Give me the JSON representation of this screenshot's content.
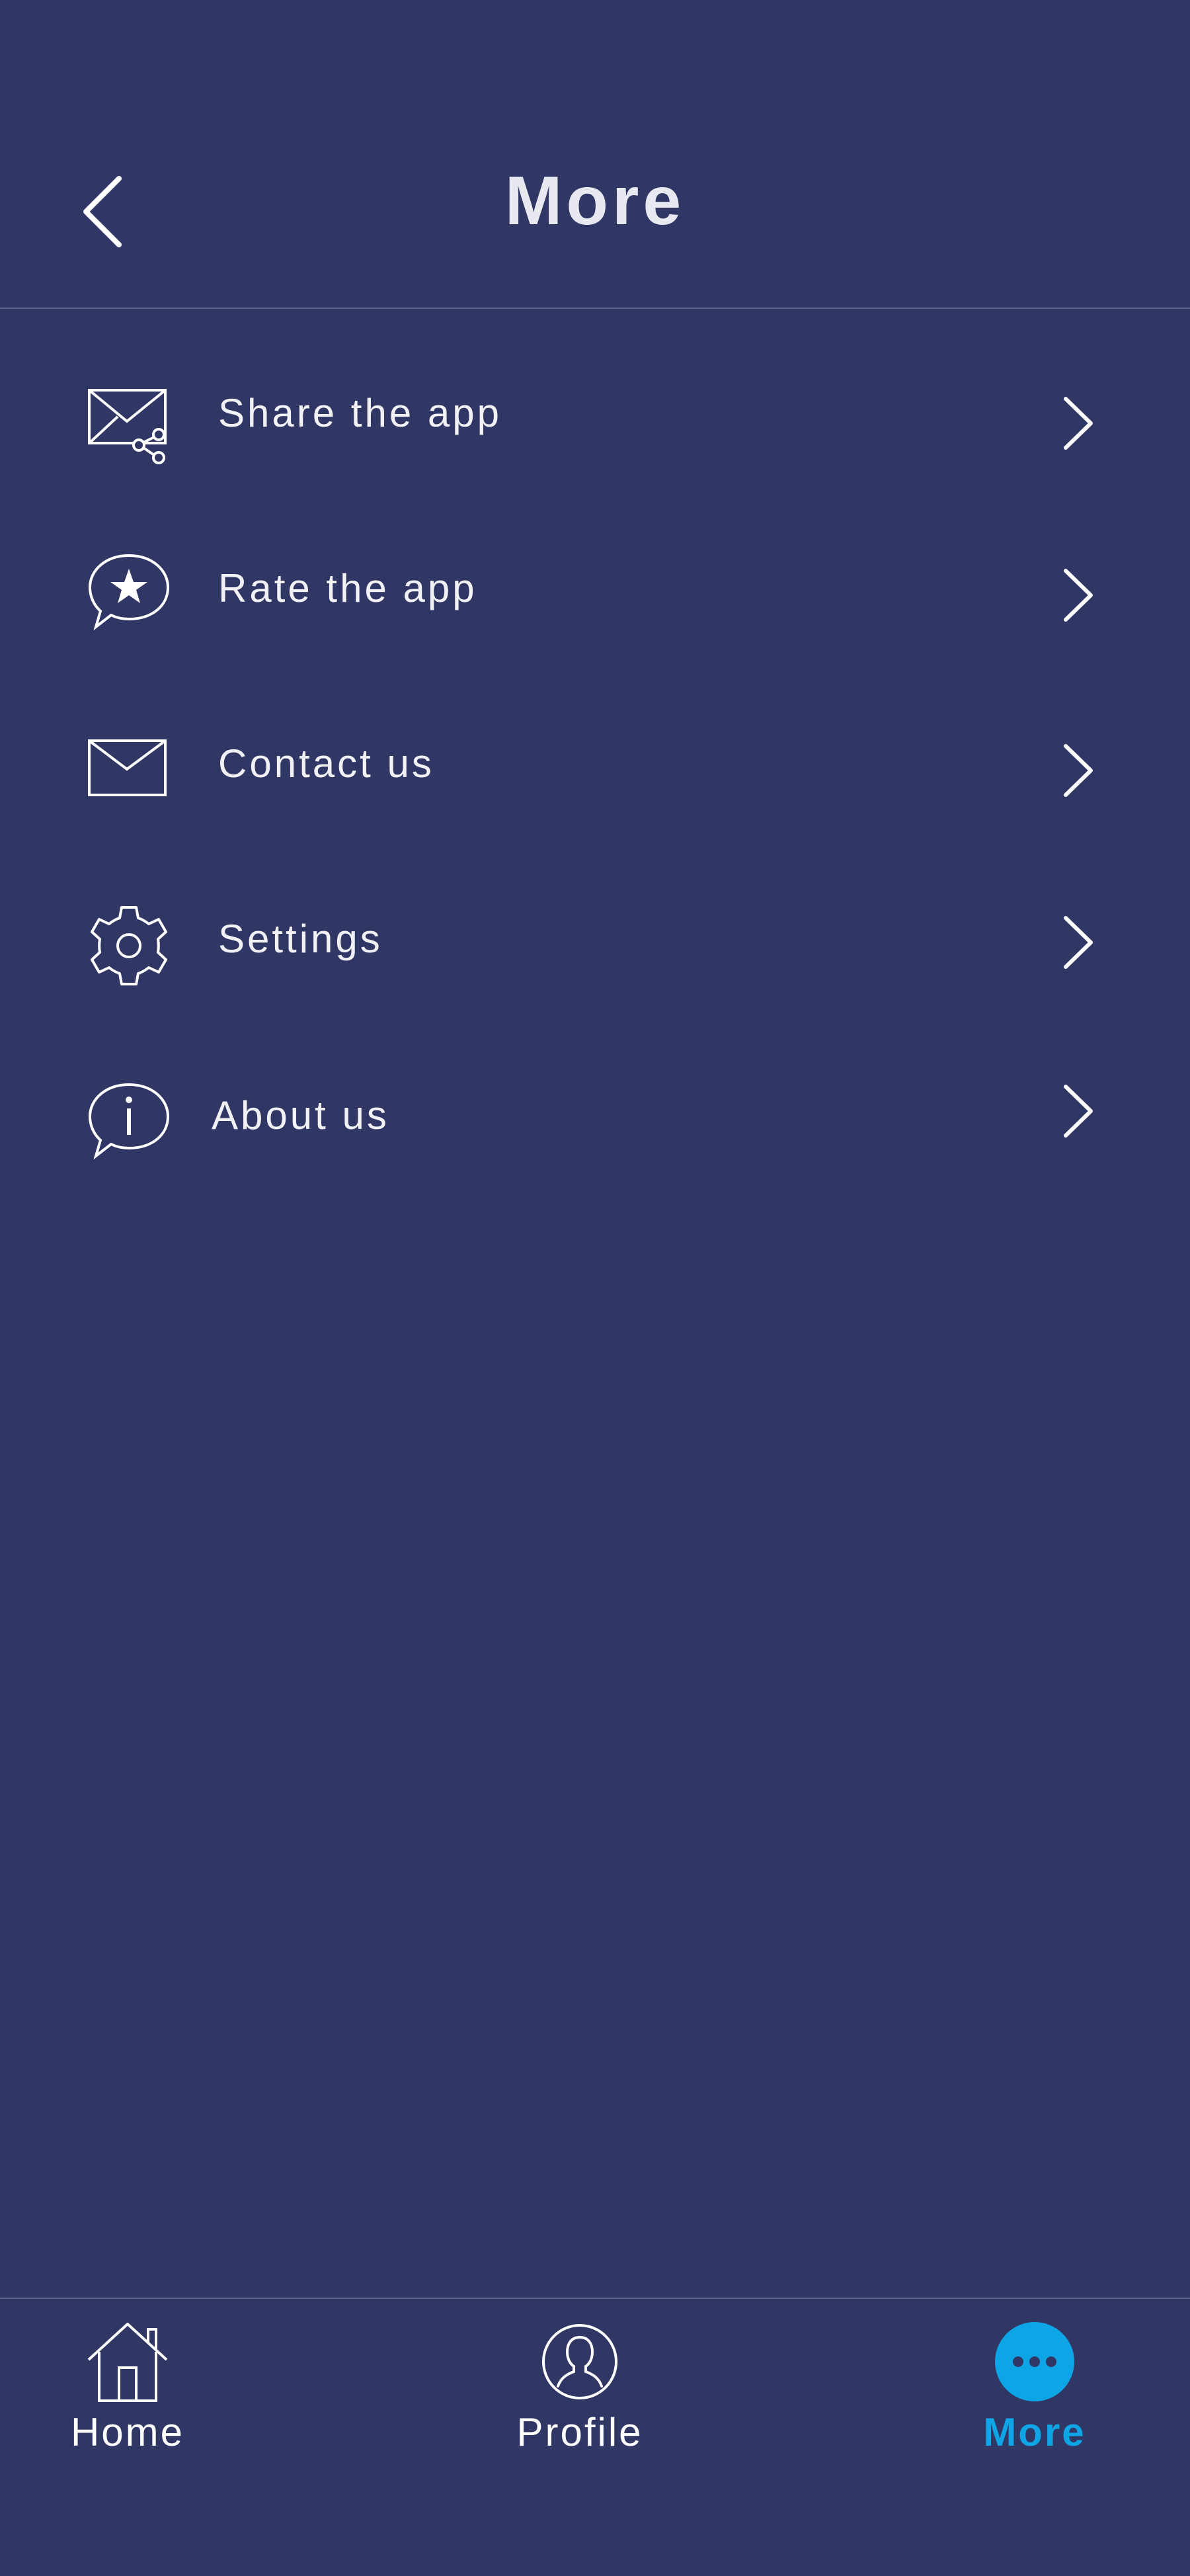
{
  "header": {
    "title": "More",
    "back_icon": "chevron-left-icon"
  },
  "menu": {
    "items": [
      {
        "label": "Share the app",
        "icon": "share-envelope-icon"
      },
      {
        "label": "Rate the app",
        "icon": "star-speech-bubble-icon"
      },
      {
        "label": "Contact us",
        "icon": "envelope-icon"
      },
      {
        "label": "Settings",
        "icon": "gear-icon"
      },
      {
        "label": "About us",
        "icon": "info-speech-bubble-icon"
      }
    ],
    "chevron_icon": "chevron-right-icon"
  },
  "tabbar": {
    "tabs": [
      {
        "label": "Home",
        "icon": "home-icon",
        "active": false
      },
      {
        "label": "Profile",
        "icon": "profile-icon",
        "active": false
      },
      {
        "label": "More",
        "icon": "more-dots-icon",
        "active": true
      }
    ]
  },
  "colors": {
    "background": "#303764",
    "divider": "#5e658d",
    "text": "#ffffff",
    "accent": "#0ea5e6"
  }
}
